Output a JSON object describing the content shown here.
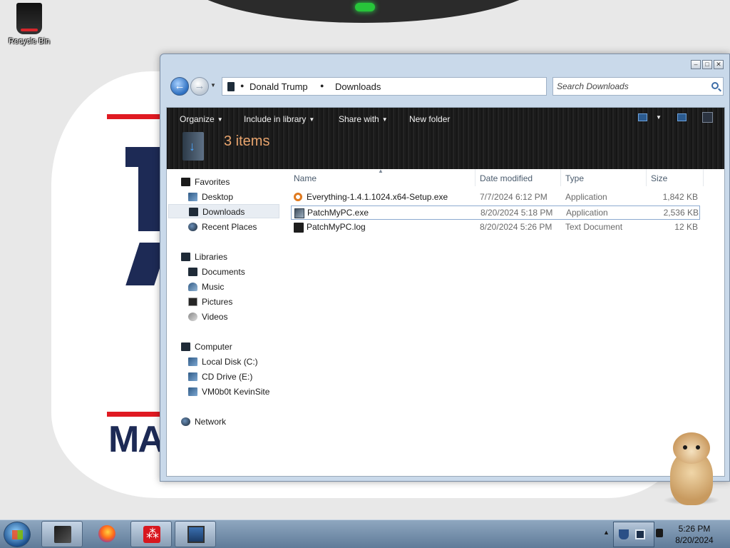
{
  "desktop": {
    "recycle_bin_label": "Recycle Bin",
    "wallpaper_text": "MA"
  },
  "window": {
    "title_buttons": [
      "minimize",
      "maximize",
      "close"
    ],
    "breadcrumb": [
      "Donald Trump",
      "Downloads"
    ],
    "search_placeholder": "Search Downloads",
    "toolbar": {
      "organize": "Organize",
      "include_in_library": "Include in library",
      "share_with": "Share with",
      "new_folder": "New folder"
    },
    "item_count": "3 items",
    "navigation": {
      "favorites": {
        "label": "Favorites",
        "items": [
          "Desktop",
          "Downloads",
          "Recent Places"
        ],
        "selected": "Downloads"
      },
      "libraries": {
        "label": "Libraries",
        "items": [
          "Documents",
          "Music",
          "Pictures",
          "Videos"
        ]
      },
      "computer": {
        "label": "Computer",
        "items": [
          "Local Disk (C:)",
          "CD Drive (E:)",
          "VM0b0t KevinSite"
        ]
      },
      "network": {
        "label": "Network"
      }
    },
    "columns": [
      "Name",
      "Date modified",
      "Type",
      "Size"
    ],
    "files": [
      {
        "name": "Everything-1.4.1.1024.x64-Setup.exe",
        "date": "7/7/2024 6:12 PM",
        "type": "Application",
        "size": "1,842 KB",
        "icon": "search-icon"
      },
      {
        "name": "PatchMyPC.exe",
        "date": "8/20/2024 5:18 PM",
        "type": "Application",
        "size": "2,536 KB",
        "icon": "exe-icon",
        "selected": true
      },
      {
        "name": "PatchMyPC.log",
        "date": "8/20/2024 5:26 PM",
        "type": "Text Document",
        "size": "12 KB",
        "icon": "log-icon"
      }
    ]
  },
  "taskbar": {
    "pinned": [
      "explorer-icon",
      "firefox-icon",
      "acrobat-icon",
      "remote-desktop-icon"
    ],
    "clock_time": "5:26 PM",
    "clock_date": "8/20/2024"
  },
  "colors": {
    "accent_blue": "#2d6fc0",
    "command_bar": "#1b1b1b",
    "item_count_text": "#e9a56e",
    "wallpaper_red": "#e01a22",
    "wallpaper_navy": "#1d2a55"
  }
}
